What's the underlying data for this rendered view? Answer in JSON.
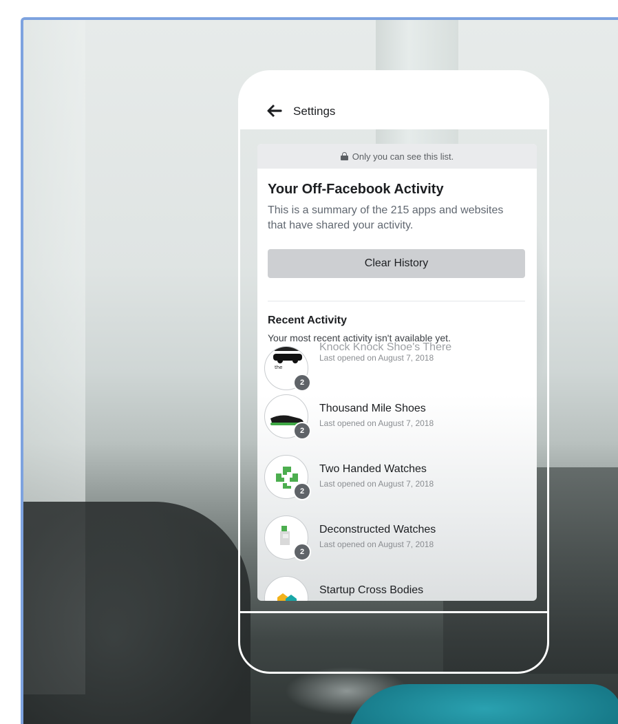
{
  "header": {
    "back_label": "Settings"
  },
  "privacy_banner": "Only you can see this list.",
  "activity": {
    "title": "Your Off-Facebook Activity",
    "subtitle": "This is a summary of the 215 apps and websites that have shared your activity.",
    "clear_button": "Clear History",
    "recent_title": "Recent Activity",
    "recent_subtitle": "Your most recent activity isn't available yet."
  },
  "apps": [
    {
      "name": "Knock Knock Shoe's There",
      "date": "Last opened on August 7, 2018",
      "badge": "2",
      "icon": "shoe-brand-logo-icon"
    },
    {
      "name": "Thousand Mile Shoes",
      "date": "Last opened on August 7, 2018",
      "badge": "2",
      "icon": "sneaker-icon"
    },
    {
      "name": "Two Handed Watches",
      "date": "Last opened on August 7, 2018",
      "badge": "2",
      "icon": "green-cross-logo-icon"
    },
    {
      "name": "Deconstructed Watches",
      "date": "Last opened on August 7, 2018",
      "badge": "2",
      "icon": "watch-flag-logo-icon"
    },
    {
      "name": "Startup Cross Bodies",
      "date": "",
      "badge": "",
      "icon": "hexagon-logo-icon"
    }
  ],
  "colors": {
    "frame_border": "#7da2df",
    "button_bg": "#cdcfd2",
    "badge_bg": "#5f6368",
    "pillow_teal": "#1f8e9d"
  }
}
